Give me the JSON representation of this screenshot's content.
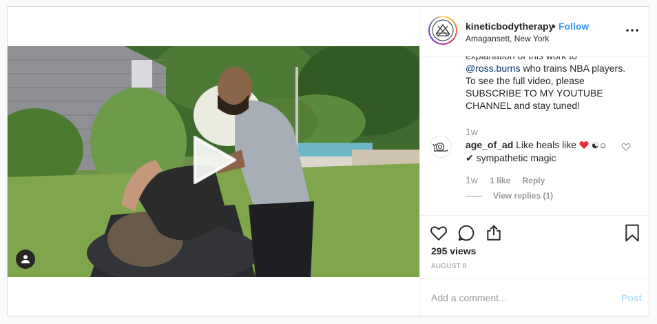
{
  "post": {
    "username": "kineticbodytherapy",
    "separator": "•",
    "follow_label": "Follow",
    "location": "Amagansett, New York",
    "caption": {
      "line0": "explanation of this work to",
      "mention": "@ross.burns",
      "after_mention": " who trains NBA players.",
      "rest": "To see the full video, please SUBSCRIBE TO MY YOUTUBE CHANNEL and stay tuned!"
    },
    "caption_time": "1w",
    "comment": {
      "username": "age_of_ad",
      "text_a": "Like heals like",
      "emojis": "☯☺",
      "text_b": "✔ sympathetic magic",
      "time": "1w",
      "likes": "1 like",
      "reply_label": "Reply",
      "view_replies": "View replies (1)"
    },
    "views": "295 views",
    "date": "AUGUST 8",
    "add_comment_placeholder": "Add a comment...",
    "post_label": "Post"
  },
  "icons": {
    "heart": "heart-icon",
    "comment": "comment-icon",
    "share": "share-icon",
    "bookmark": "bookmark-icon",
    "more": "more-options-icon",
    "play": "play-icon",
    "user_tag": "user-tag-icon"
  },
  "colors": {
    "link": "#3897f0",
    "mention": "#003569",
    "muted": "#999999",
    "post_disabled": "#b2dffc",
    "heart_emoji": "#ed2939"
  }
}
